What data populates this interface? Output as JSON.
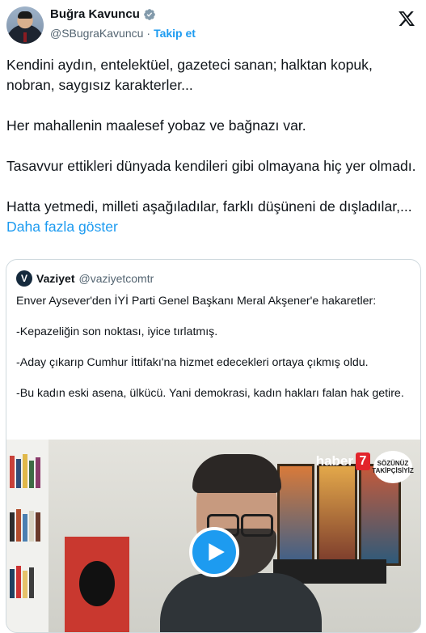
{
  "author": {
    "name": "Buğra Kavuncu",
    "handle": "@SBugraKavuncu",
    "separator": "·",
    "follow_label": "Takip et"
  },
  "tweet": {
    "paragraphs": [
      "Kendini aydın, entelektüel, gazeteci sanan; halktan kopuk, nobran, saygısız karakterler...",
      "Her mahallenin maalesef yobaz ve bağnazı var.",
      "Tasavvur ettikleri dünyada kendileri gibi olmayana hiç yer olmadı."
    ],
    "last_paragraph": "Hatta yetmedi, milleti aşağıladılar, farklı düşüneni de dışladılar,...",
    "show_more": "Daha fazla göster"
  },
  "quote": {
    "avatar_letter": "V",
    "name": "Vaziyet",
    "handle": "@vaziyetcomtr",
    "paragraphs": [
      "Enver Aysever'den İYİ Parti Genel Başkanı Meral Akşener'e hakaretler:",
      "-Kepazeliğin son noktası, iyice tırlatmış.",
      "-Aday çıkarıp Cumhur İttifakı'na hizmet edecekleri ortaya çıkmış oldu.",
      "-Bu kadın eski asena, ülkücü. Yani demokrasi, kadın hakları falan hak getire."
    ],
    "video": {
      "logo_text": "haber",
      "logo_number": "7",
      "badge_text": "SÖZÜNÜZ TAKİPÇİSİYİZ"
    }
  },
  "colors": {
    "accent": "#1d9bf0",
    "text": "#0f1419",
    "muted": "#536471",
    "border": "#cfd9de"
  },
  "icons": [
    "verified-badge-icon",
    "x-logo-icon",
    "play-icon"
  ]
}
